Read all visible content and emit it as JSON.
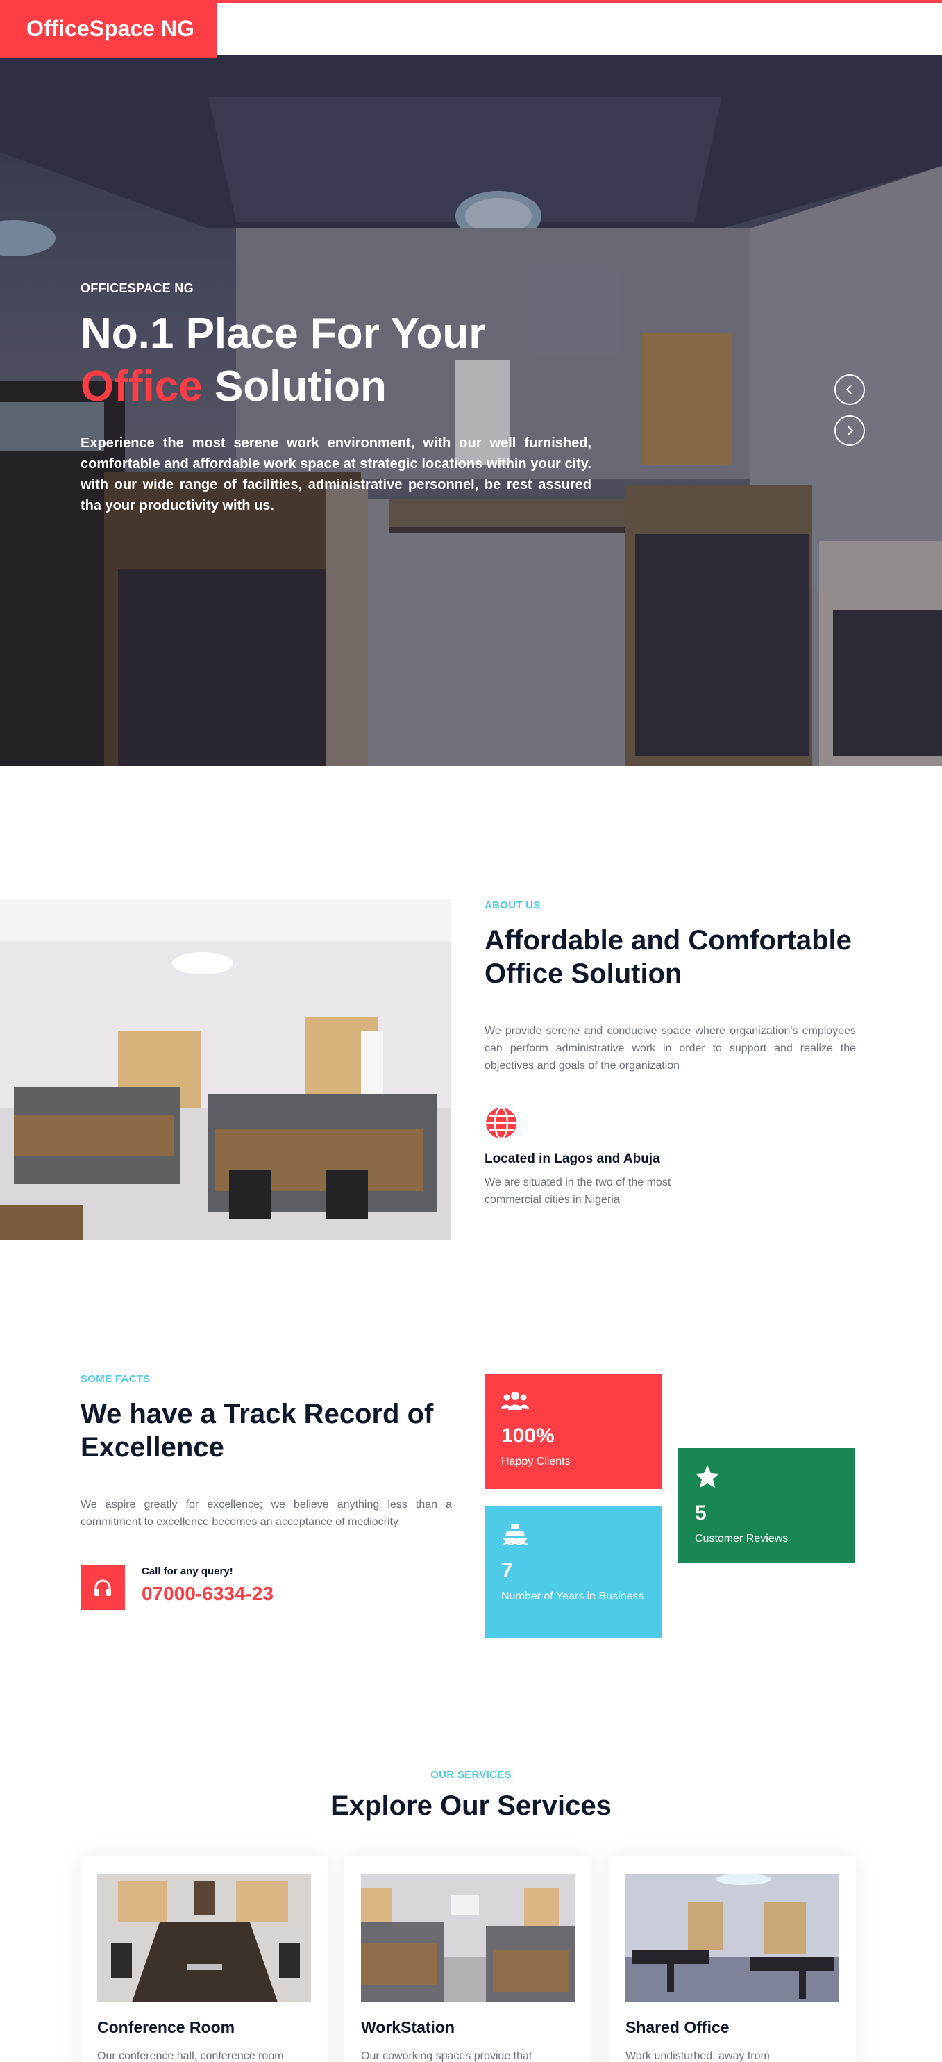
{
  "brand": {
    "name": "OfficeSpace NG",
    "color": "#fe3d44"
  },
  "hero": {
    "kicker": "OFFICESPACE NG",
    "title_line1": "No.1 Place For Your",
    "title_accent": "Office",
    "title_rest": " Solution",
    "description": "Experience the most serene work environment, with our well furnished, comfortable and affordable work space at strategic locations within your city. with our wide range of facilities, administrative personnel, be rest assured tha your productivity with us.",
    "prev_icon": "chevron-left-icon",
    "next_icon": "chevron-right-icon"
  },
  "about": {
    "kicker": "ABOUT US",
    "title": "Affordable and Comfortable Office Solution",
    "text": "We provide serene and conducive space where organization's employees can perform administrative work in order to support and realize the objectives and goals of the organization",
    "feature": {
      "icon": "globe-icon",
      "title": "Located in Lagos and Abuja",
      "text": "We are situated in the two of the most commercial cities in Nigeria"
    }
  },
  "facts": {
    "kicker": "SOME FACTS",
    "title": "We have a Track Record of Excellence",
    "text": "We aspire greatly for excellence; we believe anything less than a commitment to excellence becomes an acceptance of mediocrity",
    "call": {
      "icon": "headphones-icon",
      "label": "Call for any query!",
      "number": "07000-6334-23"
    },
    "stats": [
      {
        "icon": "users-icon",
        "value": "100%",
        "label": "Happy Clients",
        "color": "#fe3d44"
      },
      {
        "icon": "star-icon",
        "value": "5",
        "label": "Customer Reviews",
        "color": "#198754"
      },
      {
        "icon": "ship-icon",
        "value": "7",
        "label": "Number of Years in Business",
        "color": "#4ecbe9"
      }
    ]
  },
  "services": {
    "kicker": "OUR SERVICES",
    "title": "Explore Our Services",
    "cards": [
      {
        "title": "Conference Room",
        "text": "Our conference hall, conference room"
      },
      {
        "title": "WorkStation",
        "text": "Our coworking spaces provide that"
      },
      {
        "title": "Shared Office",
        "text": "Work undisturbed, away from"
      }
    ]
  },
  "colors": {
    "accent": "#fe3d44",
    "cyan": "#4ecbe9",
    "green": "#198754",
    "dark": "#0f172b"
  }
}
